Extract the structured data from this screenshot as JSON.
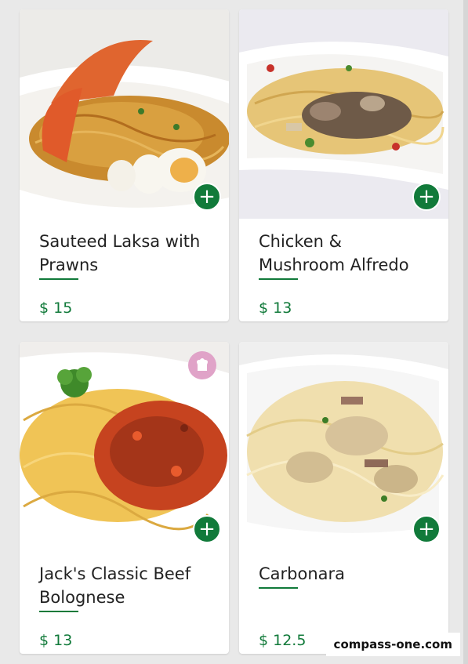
{
  "menu": {
    "items": [
      {
        "name": "Sauteed Laksa with Prawns",
        "price": "$ 15",
        "add_icon": "plus-icon",
        "badge": null
      },
      {
        "name": "Chicken & Mushroom Alfredo",
        "price": "$ 13",
        "add_icon": "plus-icon",
        "badge": null
      },
      {
        "name": "Jack's Classic Beef Bolognese",
        "price": "$ 13",
        "add_icon": "plus-icon",
        "badge": "chef-hat-icon"
      },
      {
        "name": "Carbonara",
        "price": "$ 12.5",
        "add_icon": "plus-icon",
        "badge": null
      }
    ]
  },
  "watermark": {
    "text": "compass-one.com"
  },
  "colors": {
    "accent": "#117a3a",
    "badge": "#e0a3c8",
    "background": "#e9e9e9"
  }
}
